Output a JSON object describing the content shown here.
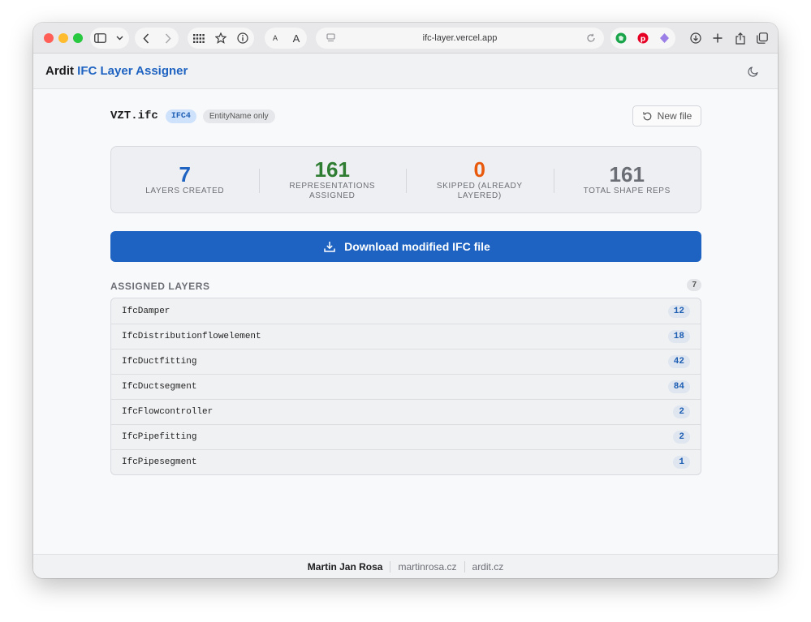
{
  "browser": {
    "url": "ifc-layer.vercel.app",
    "text_size_small": "A",
    "text_size_large": "A",
    "icons": {
      "sidebar": "sidebar-icon",
      "chevron": "chevron-down-icon",
      "back": "back-icon",
      "forward": "forward-icon",
      "grid": "grid-icon",
      "star": "star-icon",
      "info": "info-icon",
      "page": "page-icon",
      "reload": "reload-icon",
      "ext1": "evernote-icon",
      "ext2": "pinterest-icon",
      "ext3": "extension-icon",
      "download": "download-icon",
      "new_tab": "plus-icon",
      "share": "share-icon",
      "tabs": "tabs-icon"
    }
  },
  "app": {
    "brand_part1": "Ardit",
    "brand_part2": "IFC Layer Assigner",
    "theme_icon": "moon-icon"
  },
  "file": {
    "name": "VZT.ifc",
    "schema_badge": "IFC4",
    "mode_badge": "EntityName only",
    "new_file_label": "New file"
  },
  "stats": [
    {
      "value": "7",
      "label": "LAYERS CREATED",
      "color": "#1e63c1"
    },
    {
      "value": "161",
      "label": "REPRESENTATIONS ASSIGNED",
      "color": "#2e7d32"
    },
    {
      "value": "0",
      "label": "SKIPPED (ALREADY LAYERED)",
      "color": "#e8590c"
    },
    {
      "value": "161",
      "label": "TOTAL SHAPE REPS",
      "color": "#6b6e75"
    }
  ],
  "download_label": "Download modified IFC file",
  "layers": {
    "title": "ASSIGNED LAYERS",
    "count": "7",
    "items": [
      {
        "name": "IfcDamper",
        "count": "12"
      },
      {
        "name": "IfcDistributionflowelement",
        "count": "18"
      },
      {
        "name": "IfcDuctfitting",
        "count": "42"
      },
      {
        "name": "IfcDuctsegment",
        "count": "84"
      },
      {
        "name": "IfcFlowcontroller",
        "count": "2"
      },
      {
        "name": "IfcPipefitting",
        "count": "2"
      },
      {
        "name": "IfcPipesegment",
        "count": "1"
      }
    ]
  },
  "footer": {
    "author": "Martin Jan Rosa",
    "link1": "martinrosa.cz",
    "link2": "ardit.cz"
  }
}
